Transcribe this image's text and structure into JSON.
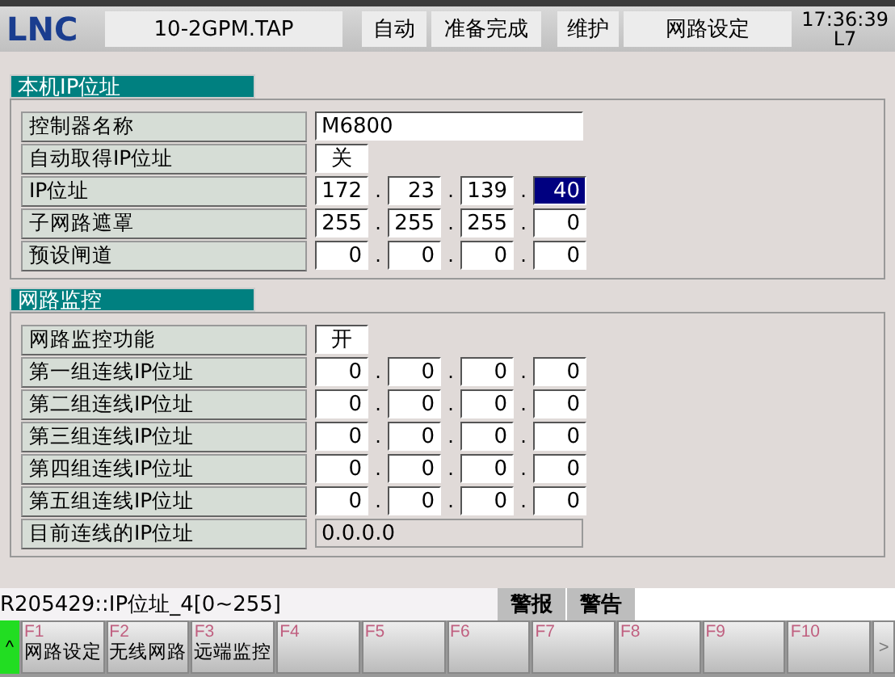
{
  "header": {
    "logo": "LNC",
    "file": "10-2GPM.TAP",
    "mode": "自动",
    "status": "准备完成",
    "category": "维护",
    "page": "网路设定",
    "time": "17:36:39",
    "line": "L7"
  },
  "sections": [
    {
      "title": "本机IP位址",
      "rows": [
        {
          "kind": "text",
          "label": "控制器名称",
          "value": "M6800"
        },
        {
          "kind": "toggle",
          "label": "自动取得IP位址",
          "value": "关"
        },
        {
          "kind": "ip",
          "label": "IP位址",
          "octets": [
            {
              "value": "172",
              "selected": false
            },
            {
              "value": "23",
              "selected": false
            },
            {
              "value": "139",
              "selected": false
            },
            {
              "value": "40",
              "selected": true
            }
          ]
        },
        {
          "kind": "ip",
          "label": "子网路遮罩",
          "octets": [
            {
              "value": "255",
              "selected": false
            },
            {
              "value": "255",
              "selected": false
            },
            {
              "value": "255",
              "selected": false
            },
            {
              "value": "0",
              "selected": false
            }
          ]
        },
        {
          "kind": "ip",
          "label": "预设闸道",
          "octets": [
            {
              "value": "0",
              "selected": false
            },
            {
              "value": "0",
              "selected": false
            },
            {
              "value": "0",
              "selected": false
            },
            {
              "value": "0",
              "selected": false
            }
          ]
        }
      ]
    },
    {
      "title": "网路监控",
      "rows": [
        {
          "kind": "toggle",
          "label": "网路监控功能",
          "value": "开"
        },
        {
          "kind": "ip",
          "label": "第一组连线IP位址",
          "octets": [
            {
              "value": "0",
              "selected": false
            },
            {
              "value": "0",
              "selected": false
            },
            {
              "value": "0",
              "selected": false
            },
            {
              "value": "0",
              "selected": false
            }
          ]
        },
        {
          "kind": "ip",
          "label": "第二组连线IP位址",
          "octets": [
            {
              "value": "0",
              "selected": false
            },
            {
              "value": "0",
              "selected": false
            },
            {
              "value": "0",
              "selected": false
            },
            {
              "value": "0",
              "selected": false
            }
          ]
        },
        {
          "kind": "ip",
          "label": "第三组连线IP位址",
          "octets": [
            {
              "value": "0",
              "selected": false
            },
            {
              "value": "0",
              "selected": false
            },
            {
              "value": "0",
              "selected": false
            },
            {
              "value": "0",
              "selected": false
            }
          ]
        },
        {
          "kind": "ip",
          "label": "第四组连线IP位址",
          "octets": [
            {
              "value": "0",
              "selected": false
            },
            {
              "value": "0",
              "selected": false
            },
            {
              "value": "0",
              "selected": false
            },
            {
              "value": "0",
              "selected": false
            }
          ]
        },
        {
          "kind": "ip",
          "label": "第五组连线IP位址",
          "octets": [
            {
              "value": "0",
              "selected": false
            },
            {
              "value": "0",
              "selected": false
            },
            {
              "value": "0",
              "selected": false
            },
            {
              "value": "0",
              "selected": false
            }
          ]
        },
        {
          "kind": "readonly",
          "label": "目前连线的IP位址",
          "value": "0.0.0.0"
        }
      ]
    }
  ],
  "ip_separator": ".",
  "message": "R205429::IP位址_4[0~255]",
  "alarm_buttons": [
    "警报",
    "警告"
  ],
  "softkeys": {
    "up": "^",
    "more": ">",
    "keys": [
      {
        "key": "F1",
        "label": "网路设定"
      },
      {
        "key": "F2",
        "label": "无线网路"
      },
      {
        "key": "F3",
        "label": "远端监控"
      },
      {
        "key": "F4"
      },
      {
        "key": "F5"
      },
      {
        "key": "F6"
      },
      {
        "key": "F7"
      },
      {
        "key": "F8"
      },
      {
        "key": "F9"
      },
      {
        "key": "F10"
      }
    ]
  }
}
